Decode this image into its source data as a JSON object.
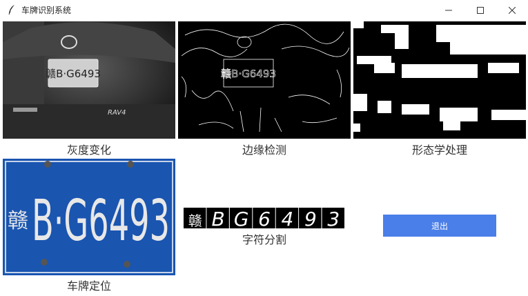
{
  "window": {
    "title": "车牌识别系统",
    "controls": [
      "minimize-icon",
      "maximize-icon",
      "close-icon"
    ]
  },
  "panels": {
    "grayscale": {
      "caption": "灰度变化",
      "plate_text": "赣B·G6493"
    },
    "edges": {
      "caption": "边缘检测",
      "plate_text": "赣B·G6493"
    },
    "morphology": {
      "caption": "形态学处理"
    },
    "plate": {
      "caption": "车牌定位",
      "province": "赣",
      "text": "B·G6493"
    },
    "segmentation": {
      "caption": "字符分割",
      "chars": [
        "赣",
        "B",
        "G",
        "6",
        "4",
        "9",
        "3"
      ]
    }
  },
  "buttons": {
    "quit_label": "退出"
  },
  "colors": {
    "accent": "#4a7ee8",
    "plate_blue": "#1a55b0"
  }
}
